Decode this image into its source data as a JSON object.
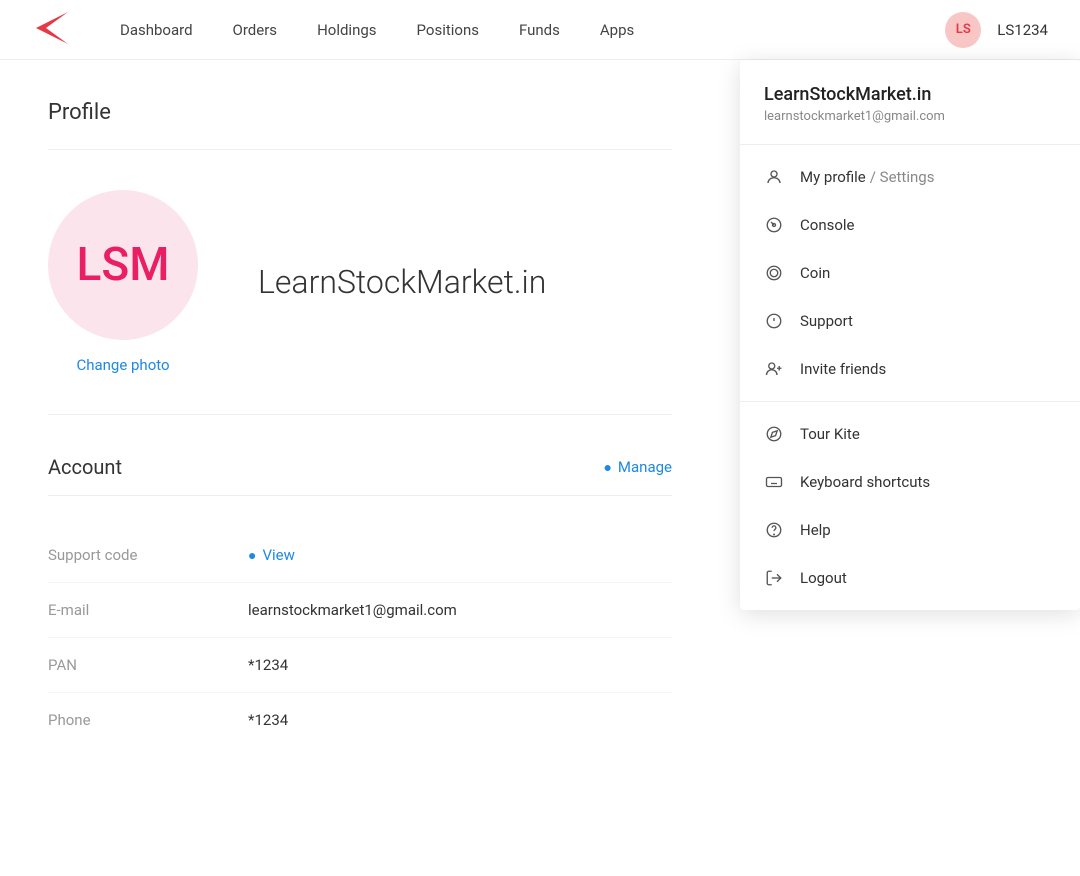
{
  "header": {
    "nav_items": [
      "Dashboard",
      "Orders",
      "Holdings",
      "Positions",
      "Funds",
      "Apps"
    ],
    "avatar_text": "LS",
    "user_id": "LS1234"
  },
  "profile": {
    "title": "Profile",
    "avatar_text": "LSM",
    "name": "LearnStockMarket.in",
    "change_photo_label": "Change photo"
  },
  "account": {
    "title": "Account",
    "manage_label": "Manage",
    "support_code_label": "Support code",
    "support_code_action": "View",
    "email_label": "E-mail",
    "email_value": "learnstockmarket1@gmail.com",
    "pan_label": "PAN",
    "pan_value": "*1234",
    "phone_label": "Phone",
    "phone_value": "*1234"
  },
  "dropdown": {
    "username": "LearnStockMarket.in",
    "email": "learnstockmarket1@gmail.com",
    "items": [
      {
        "id": "my-profile",
        "label": "My profile",
        "secondary": "/ Settings",
        "icon": "person"
      },
      {
        "id": "console",
        "label": "Console",
        "icon": "gauge"
      },
      {
        "id": "coin",
        "label": "Coin",
        "icon": "coin"
      },
      {
        "id": "support",
        "label": "Support",
        "icon": "support"
      },
      {
        "id": "invite",
        "label": "Invite friends",
        "icon": "person-add"
      },
      {
        "id": "tour",
        "label": "Tour Kite",
        "icon": "compass"
      },
      {
        "id": "keyboard",
        "label": "Keyboard shortcuts",
        "icon": "keyboard"
      },
      {
        "id": "help",
        "label": "Help",
        "icon": "help"
      },
      {
        "id": "logout",
        "label": "Logout",
        "icon": "logout"
      }
    ]
  }
}
